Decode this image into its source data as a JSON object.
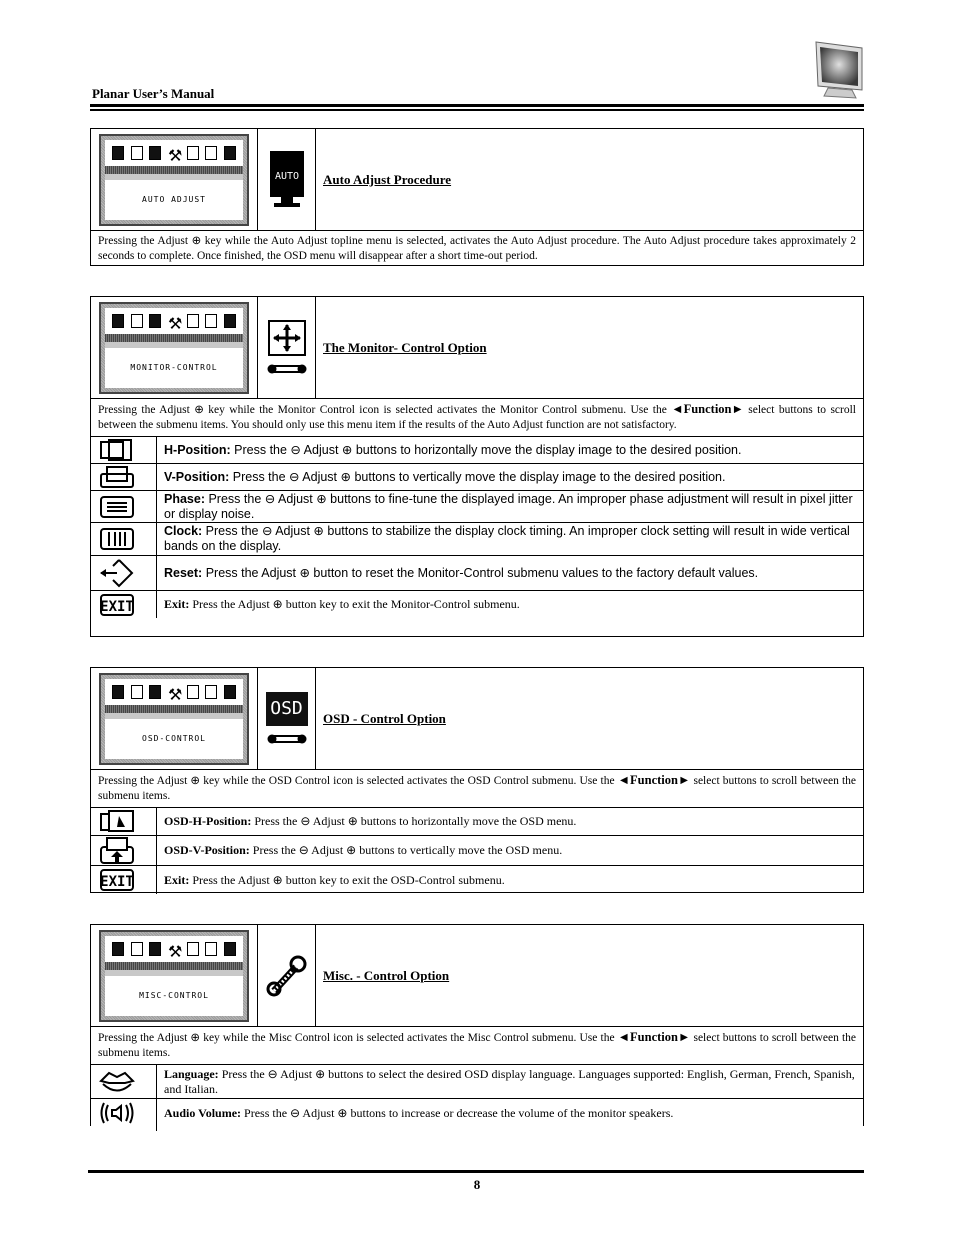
{
  "header": {
    "title": "Planar User’s Manual",
    "logo_icon": "monitor-icon"
  },
  "adjust_key_glyph": "+",
  "minus_key_glyph": "−",
  "sections": [
    {
      "osd_label": "AUTO ADJUST",
      "title": "Auto Adjust Procedure",
      "icon": "auto-adjust-icon",
      "description": "Pressing the Adjust ⊕ key while the Auto Adjust topline menu is selected, activates the Auto Adjust procedure.  The Auto Adjust procedure takes approximately 2 seconds to complete.  Once finished, the OSD menu will disappear after a short time-out period."
    },
    {
      "osd_label": "MONITOR-CONTROL",
      "title": "The Monitor- Control Option",
      "icon": "move-arrows-icon",
      "description_pre": "Pressing the Adjust ⊕ key while the Monitor Control icon is selected activates the Monitor Control submenu.  Use the ",
      "function_label": "◄Function►",
      "description_post": " select buttons to scroll between the submenu items.  You should only use this menu item if the results of the Auto Adjust function are not satisfactory.",
      "items": [
        {
          "icon": "h-position-icon",
          "label": "H-Position:",
          "text": " Press the ⊖ Adjust ⊕ buttons to horizontally move the display image to the desired position."
        },
        {
          "icon": "v-position-icon",
          "label": "V-Position:",
          "text": " Press the ⊖ Adjust ⊕ buttons to vertically move the display image to the desired position."
        },
        {
          "icon": "phase-icon",
          "label": "Phase:",
          "text": " Press the ⊖ Adjust ⊕ buttons to fine-tune the displayed image.  An improper phase adjustment will result in pixel jitter or display noise."
        },
        {
          "icon": "clock-icon",
          "label": "Clock:",
          "text": " Press the ⊖ Adjust ⊕ buttons to stabilize the display clock timing.  An improper clock setting will result in wide vertical bands on the display."
        },
        {
          "icon": "reset-icon",
          "label": "Reset:",
          "text": "  Press the Adjust ⊕ button to reset the Monitor-Control submenu values to the factory default values."
        },
        {
          "icon": "exit-icon",
          "label": "Exit:",
          "text": " Press the Adjust ⊕ button key to exit the Monitor-Control submenu."
        }
      ]
    },
    {
      "osd_label": "OSD-CONTROL",
      "title": "OSD - Control Option",
      "icon": "osd-icon",
      "icon_text": "OSD",
      "description_pre": "Pressing the Adjust ⊕ key while the OSD Control icon is selected activates the OSD Control submenu.  Use the ",
      "function_label": "◄Function►",
      "description_post": " select buttons to scroll between the submenu items.",
      "items": [
        {
          "icon": "osd-h-position-icon",
          "label": "OSD-H-Position:",
          "text": " Press the ⊖ Adjust ⊕ buttons to horizontally move the OSD menu."
        },
        {
          "icon": "osd-v-position-icon",
          "label": "OSD-V-Position:",
          "text": " Press the ⊖ Adjust ⊕ buttons to vertically move the OSD menu."
        },
        {
          "icon": "exit-icon",
          "label": "Exit:",
          "text": " Press the Adjust ⊕ button key to exit the OSD-Control submenu."
        }
      ]
    },
    {
      "osd_label": "MISC-CONTROL",
      "title": "Misc. - Control Option",
      "icon": "wrench-icon",
      "description_pre": "Pressing the Adjust ⊕ key while the Misc Control icon is selected activates the Misc Control submenu.  Use the ",
      "function_label": "◄Function►",
      "description_post": " select buttons to scroll between the submenu items.",
      "items": [
        {
          "icon": "language-icon",
          "label": "Language:",
          "text": " Press the ⊖ Adjust ⊕ buttons to select the desired OSD display language.  Languages supported:  English, German, French, Spanish, and Italian."
        },
        {
          "icon": "audio-volume-icon",
          "label": "Audio Volume:",
          "text": " Press the ⊖ Adjust ⊕ buttons to increase or decrease the volume of the monitor speakers."
        }
      ]
    }
  ],
  "footer": {
    "page_number": "8"
  }
}
